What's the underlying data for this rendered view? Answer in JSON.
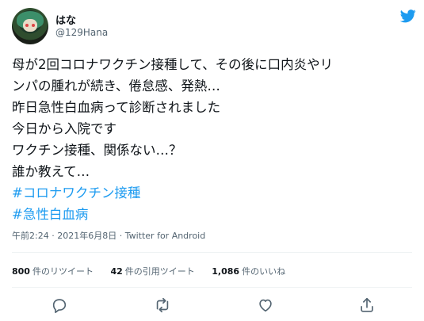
{
  "user": {
    "name": "はな",
    "handle": "@129Hana"
  },
  "tweet": {
    "lines": [
      "母が2回コロナワクチン接種して、その後に口内炎やリ",
      "ンパの腫れが続き、倦怠感、発熱…",
      "昨日急性白血病って診断されました",
      "今日から入院です",
      "ワクチン接種、関係ない…？",
      "誰か教えて…"
    ],
    "hashtags": [
      "#コロナワクチン接種",
      "#急性白血病"
    ]
  },
  "meta": {
    "time": "午前2:24",
    "separator1": " · ",
    "date": "2021年6月8日",
    "separator2": " · ",
    "client": "Twitter for Android"
  },
  "stats": {
    "retweets": {
      "count": "800",
      "label": "件のリツイート"
    },
    "quotes": {
      "count": "42",
      "label": "件の引用ツイート"
    },
    "likes": {
      "count": "1,086",
      "label": "件のいいね"
    }
  },
  "colors": {
    "accent": "#1d9bf0",
    "text": "#0f1419",
    "secondary": "#536471",
    "divider": "#eff3f4"
  },
  "icons": {
    "logo": "twitter-bird-icon",
    "reply": "reply-icon",
    "retweet": "retweet-icon",
    "like": "heart-icon",
    "share": "share-icon"
  }
}
